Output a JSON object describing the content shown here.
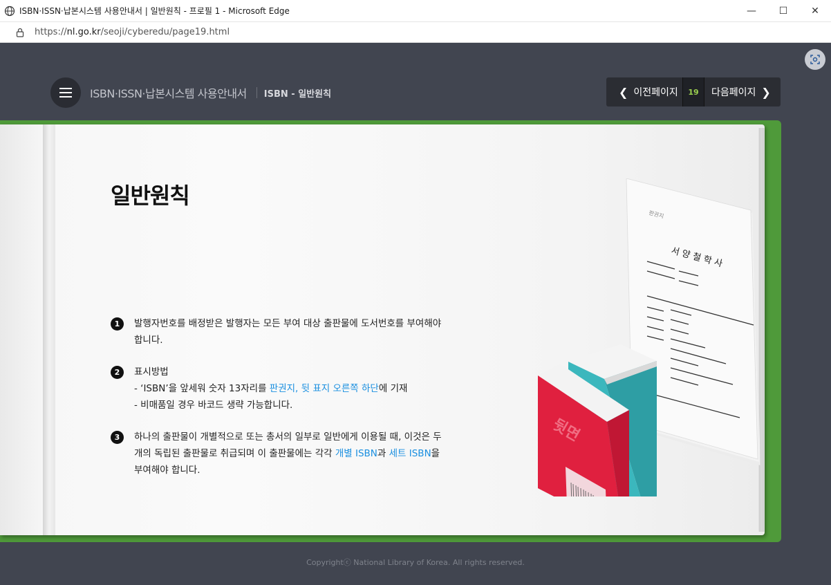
{
  "window": {
    "title": "ISBN·ISSN·납본시스템 사용안내서 | 일반원칙 - 프로필 1 - Microsoft Edge",
    "url_prefix": "https://",
    "url_domain": "nl.go.kr",
    "url_path": "/seoji/cyberedu/page19.html"
  },
  "header": {
    "site_title": "ISBN·ISSN·납본시스템 사용안내서",
    "sub_title": "ISBN - 일반원칙"
  },
  "pager": {
    "prev_label": "이전페이지",
    "page_number": "19",
    "next_label": "다음페이지"
  },
  "content": {
    "heading": "일반원칙",
    "items": [
      {
        "number": "1",
        "text": "발행자번호를 배정받은 발행자는 모든 부여 대상 출판물에 도서번호를 부여해야 합니다."
      },
      {
        "number": "2",
        "title": "표시방법",
        "line1_pre": "- ‘ISBN’을 앞세워 숫자 13자리를 ",
        "line1_hl": "판권지, 뒷 표지 오른쪽 하단",
        "line1_post": "에 기재",
        "line2": "- 비매품일 경우 바코드 생략 가능합니다."
      },
      {
        "number": "3",
        "text_pre": "하나의 출판물이 개별적으로 또는 총서의 일부로 일반에게 이용될 때, 이것은 두 개의 독립된 출판물로 취급되며 이 출판물에는 각각 ",
        "hl1": "개별 ISBN",
        "mid": "과 ",
        "hl2": "세트 ISBN",
        "text_post": "을 부여해야 합니다."
      }
    ]
  },
  "illustration": {
    "book_label": "뒷면",
    "paper_heading": "판권지",
    "paper_title": "서 양 철 학 사"
  },
  "footer": {
    "copyright": "Copyrightⓒ National Library of Korea. All rights reserved."
  },
  "colors": {
    "accent_link": "#1a8fe0",
    "page_number": "#9bd04f",
    "book_cover_green": "#4f9a3a",
    "red_book": "#e0203f",
    "teal_book": "#3bb7bd"
  }
}
